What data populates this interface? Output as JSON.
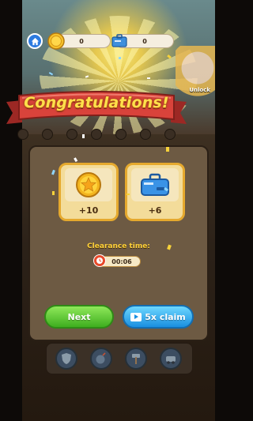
{
  "hud": {
    "coins": "0",
    "tools": "0"
  },
  "banner": {
    "title": "Congratulations!"
  },
  "scene": {
    "unlock_text": "Unlock"
  },
  "rewards": [
    {
      "icon": "star-coin-icon",
      "count": "+10"
    },
    {
      "icon": "toolbox-icon",
      "count": "+6"
    }
  ],
  "clearance": {
    "label": "Clearance time:",
    "time": "00:06"
  },
  "buttons": {
    "next": "Next",
    "claim": "5x claim"
  },
  "tools": [
    {
      "icon": "shield-icon"
    },
    {
      "icon": "bomb-icon"
    },
    {
      "icon": "hammer-icon"
    },
    {
      "icon": "car-icon"
    }
  ],
  "colors": {
    "banner_red": "#d9433b",
    "next_green": "#3eae1f",
    "claim_blue": "#1a8fe0",
    "reward_gold": "#e5a92e"
  }
}
